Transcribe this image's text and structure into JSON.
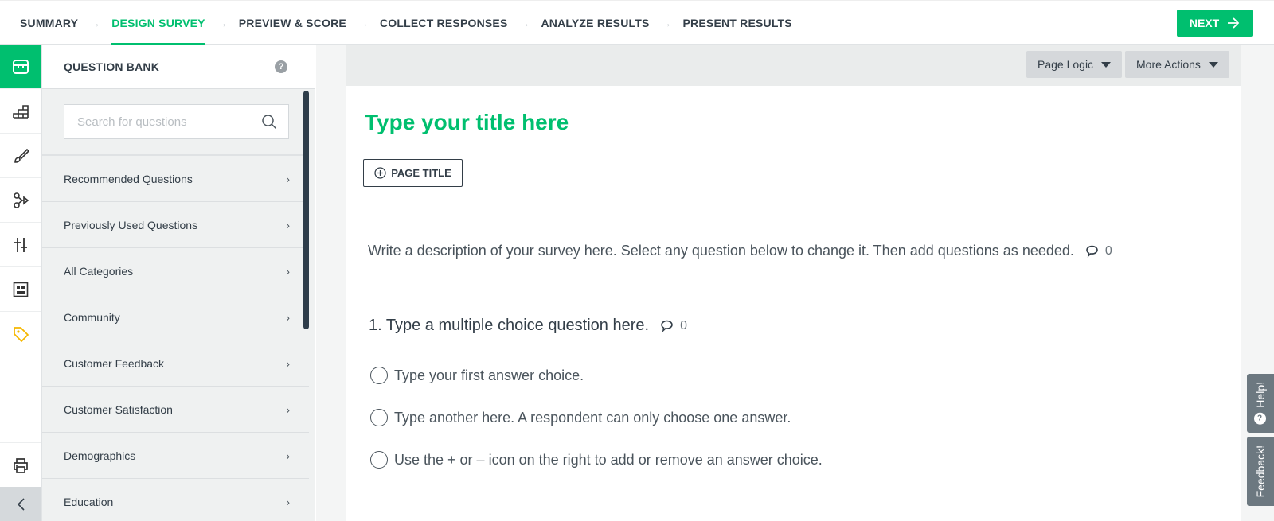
{
  "nav": {
    "steps": [
      {
        "label": "SUMMARY",
        "active": false
      },
      {
        "label": "DESIGN SURVEY",
        "active": true
      },
      {
        "label": "PREVIEW & SCORE",
        "active": false
      },
      {
        "label": "COLLECT RESPONSES",
        "active": false
      },
      {
        "label": "ANALYZE RESULTS",
        "active": false
      },
      {
        "label": "PRESENT RESULTS",
        "active": false
      }
    ],
    "step_separator": "→",
    "next_label": "NEXT",
    "next_icon": "arrow-right-icon"
  },
  "rail": {
    "items": [
      {
        "icon": "question-bank-icon",
        "active": true
      },
      {
        "icon": "builder-blocks-icon",
        "active": false
      },
      {
        "icon": "paintbrush-icon",
        "active": false
      },
      {
        "icon": "logic-branch-icon",
        "active": false
      },
      {
        "icon": "sliders-icon",
        "active": false
      },
      {
        "icon": "layout-icon",
        "active": false
      },
      {
        "icon": "tag-icon",
        "active": false
      }
    ],
    "print_icon": "printer-icon",
    "collapse_icon": "chevron-left-icon"
  },
  "question_bank": {
    "title": "QUESTION BANK",
    "help_glyph": "?",
    "search": {
      "placeholder": "Search for questions",
      "value": ""
    },
    "categories": [
      "Recommended Questions",
      "Previously Used Questions",
      "All Categories",
      "Community",
      "Customer Feedback",
      "Customer Satisfaction",
      "Demographics",
      "Education"
    ],
    "chevron": "›"
  },
  "toolbar": {
    "page_logic_label": "Page Logic",
    "more_actions_label": "More Actions"
  },
  "survey": {
    "title": "Type your title here",
    "page_title_button": "PAGE TITLE",
    "description": "Write a description of your survey here. Select any question below to change it. Then add questions as needed.",
    "description_comments": "0",
    "question": {
      "text": "1. Type a multiple choice question here.",
      "comments": "0",
      "answers": [
        "Type your first answer choice.",
        "Type another here. A respondent can only choose one answer.",
        "Use the + or – icon on the right to add or remove an answer choice."
      ]
    }
  },
  "side_tabs": {
    "help_label": "Help!",
    "feedback_label": "Feedback!"
  },
  "colors": {
    "accent": "#00bf6f",
    "text": "#333e48",
    "side_tab": "#6c7880",
    "tag_icon": "#f5b700"
  }
}
